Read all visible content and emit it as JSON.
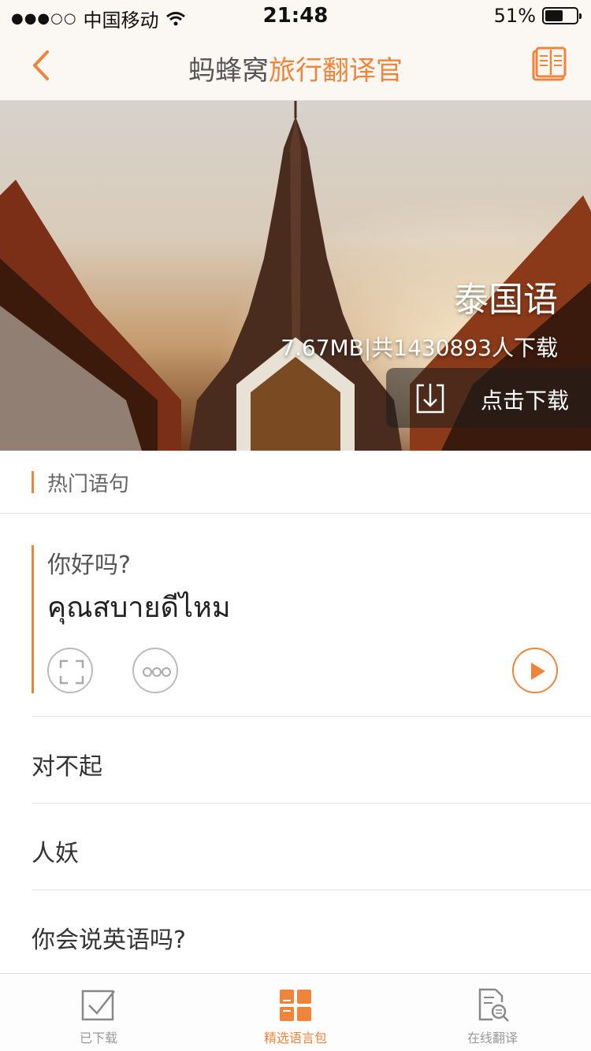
{
  "status_bar": {
    "signal": "●●●○○",
    "carrier": "中国移动",
    "time": "21:48",
    "battery_text": "51%",
    "battery_level": 0.51
  },
  "nav": {
    "title_part1": "蚂蜂窝",
    "title_part2": "旅行翻译官",
    "back_icon": "chevron-left-icon",
    "right_icon": "book-icon"
  },
  "hero": {
    "language": "泰国语",
    "meta": "7.67MB|共1430893人下载",
    "download_label": "点击下载"
  },
  "section": {
    "title": "热门语句"
  },
  "selected_phrase": {
    "chinese": "你好吗?",
    "thai": "คุณสบายดีไหม"
  },
  "phrases": [
    {
      "text": "对不起"
    },
    {
      "text": "人妖"
    },
    {
      "text": "你会说英语吗?"
    }
  ],
  "tabs": [
    {
      "label": "已下载",
      "icon": "checkbox-icon",
      "active": false
    },
    {
      "label": "精选语言包",
      "icon": "grid-package-icon",
      "active": true
    },
    {
      "label": "在线翻译",
      "icon": "document-search-icon",
      "active": false
    }
  ],
  "colors": {
    "accent": "#f0843b",
    "text": "#333333",
    "muted": "#999999"
  }
}
